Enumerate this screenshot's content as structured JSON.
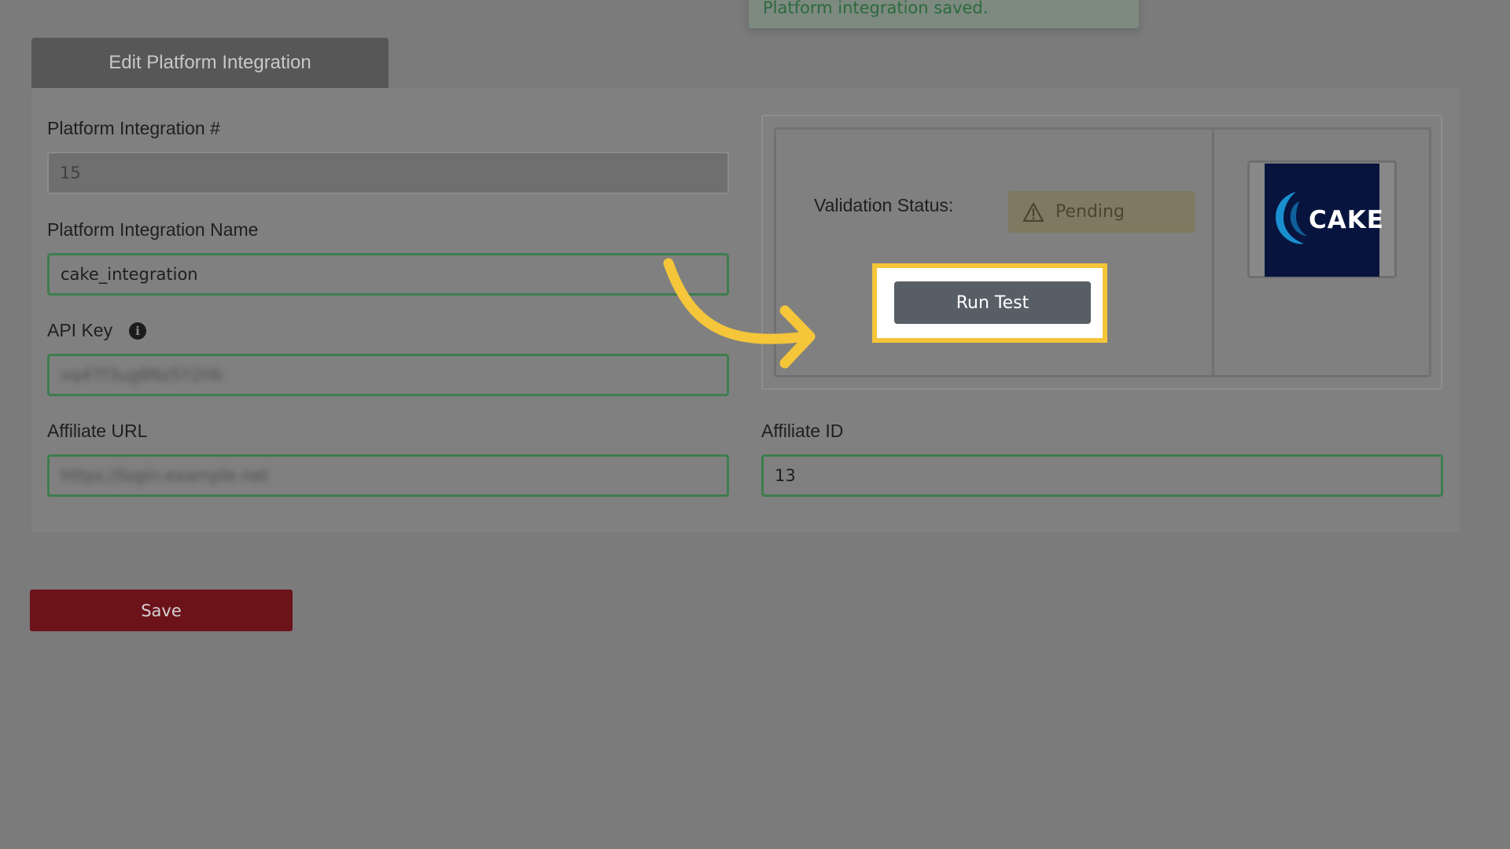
{
  "toast": {
    "message": "Platform integration saved."
  },
  "tab": {
    "label": "Edit Platform Integration"
  },
  "form": {
    "integration_number": {
      "label": "Platform Integration #",
      "value": "15"
    },
    "integration_name": {
      "label": "Platform Integration Name",
      "value": "cake_integration"
    },
    "api_key": {
      "label": "API Key",
      "value": "xq47f3ug8Nz5Y2Hk"
    },
    "affiliate_url": {
      "label": "Affiliate URL",
      "value": "https://login.example.net"
    },
    "affiliate_id": {
      "label": "Affiliate ID",
      "value": "13"
    }
  },
  "validation": {
    "label": "Validation Status:",
    "status": "Pending",
    "run_test_label": "Run Test",
    "logo_text": "CAKE"
  },
  "actions": {
    "save_label": "Save"
  },
  "colors": {
    "highlight": "#f5c53a",
    "save": "#6c1219",
    "field_border": "#3d7d4d",
    "logo_bg": "#07153e"
  }
}
